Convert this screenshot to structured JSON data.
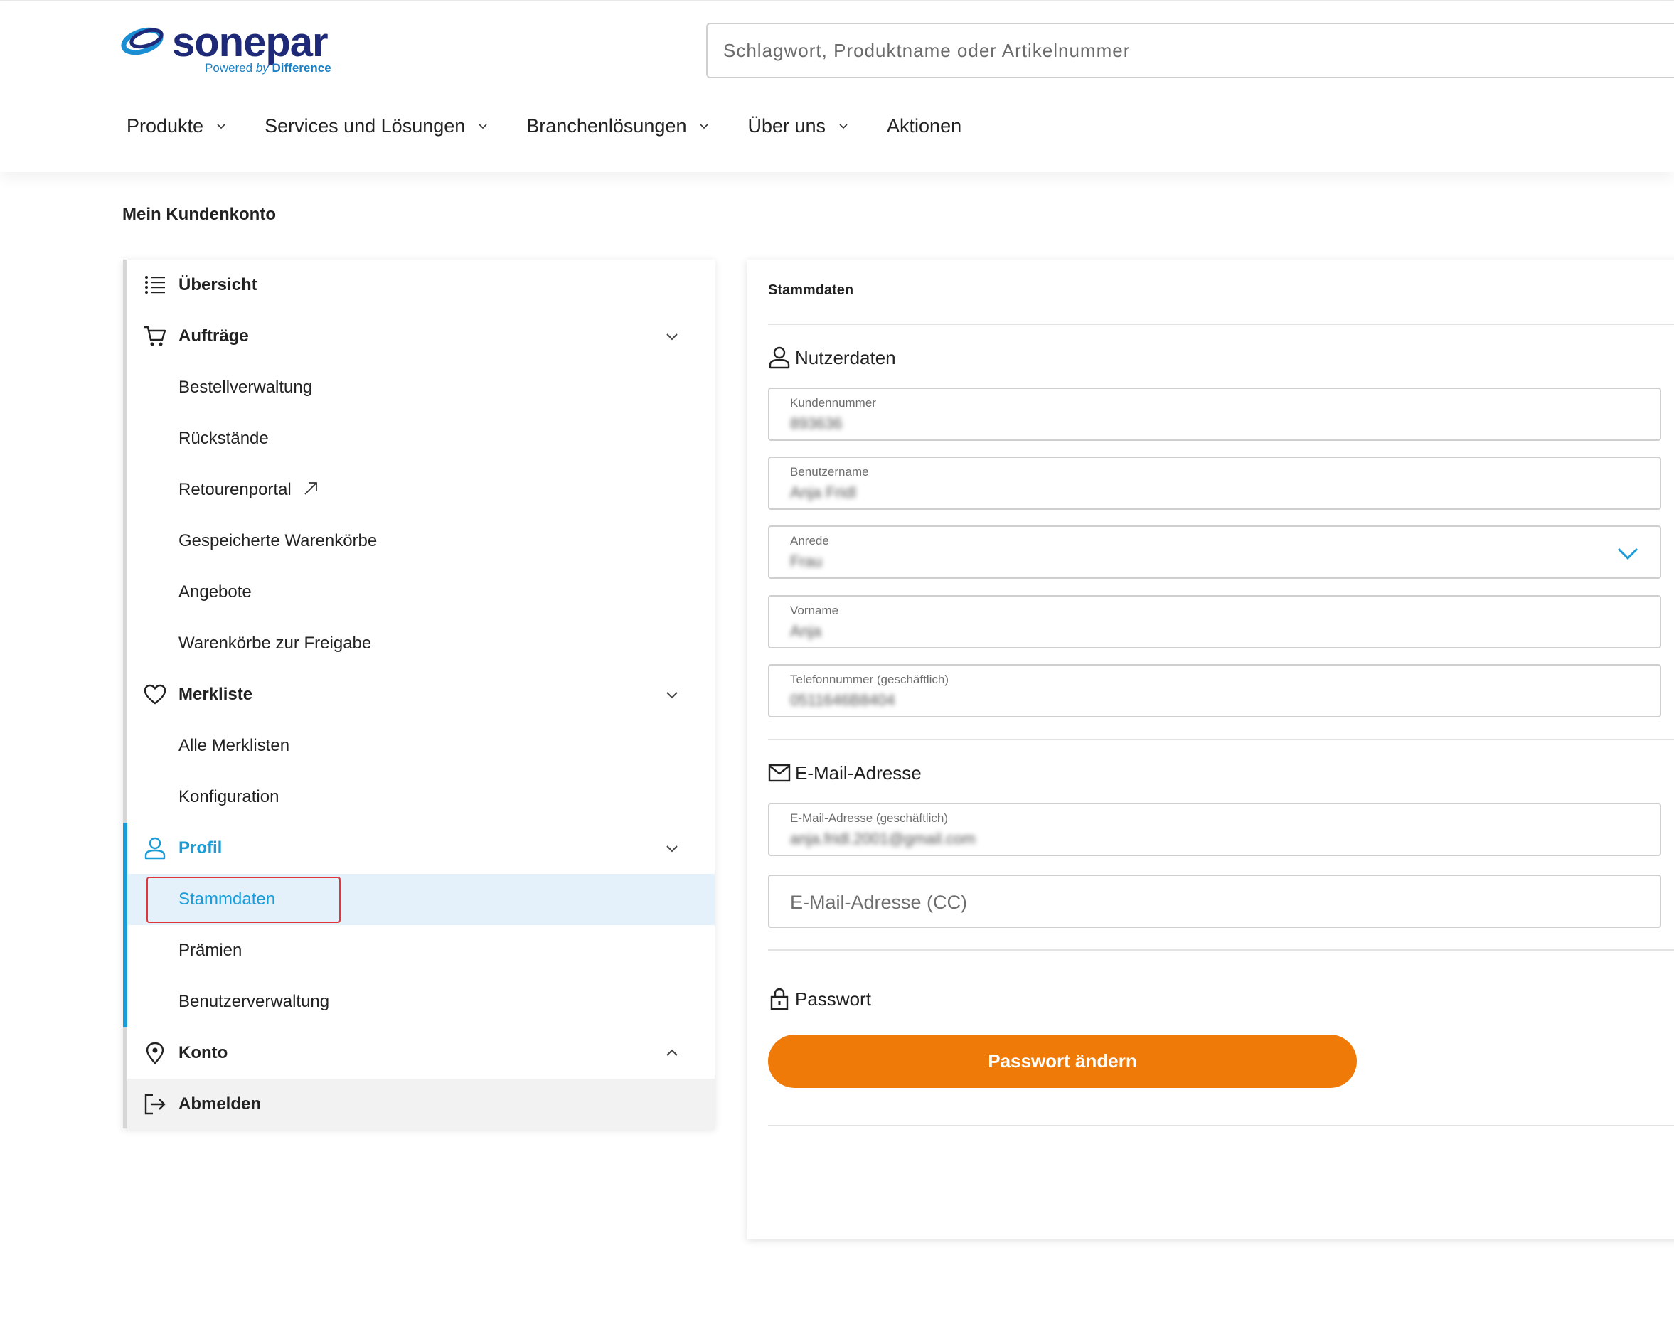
{
  "brand": {
    "name": "sonepar",
    "tagline_prefix": "Powered ",
    "tagline_by": "by",
    "tagline_suffix": " Difference",
    "color": "#1e2a78",
    "accent": "#1b7fc3"
  },
  "search": {
    "placeholder": "Schlagwort, Produktname oder Artikelnummer"
  },
  "nav": [
    {
      "label": "Produkte",
      "has_dropdown": true
    },
    {
      "label": "Services und Lösungen",
      "has_dropdown": true
    },
    {
      "label": "Branchenlösungen",
      "has_dropdown": true
    },
    {
      "label": "Über uns",
      "has_dropdown": true
    },
    {
      "label": "Aktionen",
      "has_dropdown": false
    }
  ],
  "page": {
    "title": "Mein Kundenkonto"
  },
  "sidebar": {
    "items": [
      {
        "label": "Übersicht",
        "icon": "list-icon"
      },
      {
        "label": "Aufträge",
        "icon": "cart-icon"
      },
      {
        "label": "Bestellverwaltung"
      },
      {
        "label": "Rückstände"
      },
      {
        "label": "Retourenportal",
        "icon": "external-link-icon"
      },
      {
        "label": "Gespeicherte Warenkörbe"
      },
      {
        "label": "Angebote"
      },
      {
        "label": "Warenkörbe zur Freigabe"
      },
      {
        "label": "Merkliste",
        "icon": "heart-icon"
      },
      {
        "label": "Alle Merklisten"
      },
      {
        "label": "Konfiguration"
      },
      {
        "label": "Profil",
        "icon": "user-icon"
      },
      {
        "label": "Stammdaten"
      },
      {
        "label": "Prämien"
      },
      {
        "label": "Benutzerverwaltung"
      },
      {
        "label": "Konto",
        "icon": "location-pin-icon"
      },
      {
        "label": "Abmelden",
        "icon": "logout-icon"
      }
    ],
    "active_color": "#1a9cd8",
    "highlight_color": "#e0353b"
  },
  "main": {
    "title": "Stammdaten",
    "user_section": {
      "heading": "Nutzerdaten",
      "icon": "user-icon"
    },
    "fields": [
      {
        "label": "Kundennummer",
        "value": "893636"
      },
      {
        "label": "Benutzername",
        "value": "Anja Fridl"
      },
      {
        "label": "Anrede",
        "value": "Frau"
      },
      {
        "label": "Vorname",
        "value": "Anja"
      },
      {
        "label": "Telefonnummer (geschäftlich)",
        "value": "0511646B8404"
      }
    ],
    "email_section": {
      "heading": "E-Mail-Adresse",
      "icon": "mail-icon"
    },
    "email_field": {
      "label": "E-Mail-Adresse (geschäftlich)",
      "value": "anja.fridl.2001@gmail.com"
    },
    "email_cc": {
      "placeholder": "E-Mail-Adresse (CC)"
    },
    "password_section": {
      "heading": "Passwort",
      "icon": "lock-icon"
    },
    "password_button": {
      "label": "Passwort ändern",
      "color": "#ef7a08"
    }
  }
}
